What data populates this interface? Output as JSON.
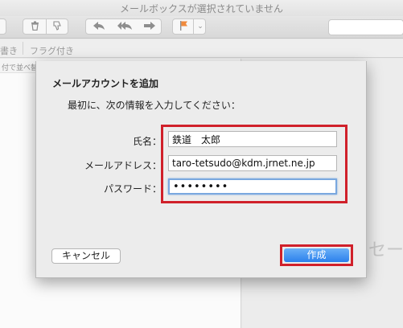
{
  "window": {
    "title": "メールボックスが選択されていません"
  },
  "filterbar": {
    "compose_partial": "書き",
    "flagged": "フラグ付き"
  },
  "listpane": {
    "sort_label": "付で並べ替"
  },
  "content": {
    "partial_text": "セー"
  },
  "dialog": {
    "title": "メールアカウントを追加",
    "subtitle": "最初に、次の情報を入力してください：",
    "name_label": "氏名：",
    "name_value": "鉄道　太郎",
    "email_label": "メールアドレス：",
    "email_value": "taro-tetsudo@kdm.jrnet.ne.jp",
    "password_label": "パスワード：",
    "password_value": "••••••••",
    "cancel_label": "キャンセル",
    "create_label": "作成"
  },
  "colors": {
    "highlight": "#d0202a",
    "primary_button": "#2b80ec",
    "focus_ring": "#7aa8df"
  }
}
